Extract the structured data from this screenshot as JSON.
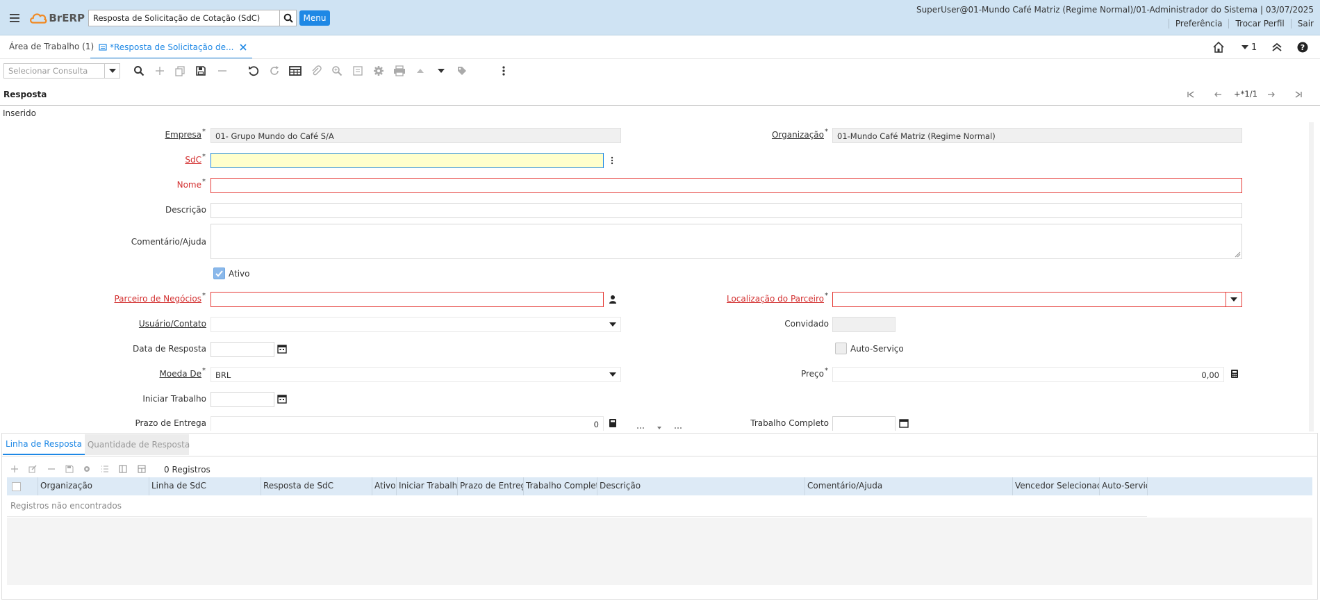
{
  "header": {
    "logo": "BrERP",
    "search_value": "Resposta de Solicitação de Cotação (SdC)",
    "menu_label": "Menu",
    "user_info": "SuperUser@01-Mundo Café Matriz (Regime Normal)/01-Administrador do Sistema | 03/07/2025",
    "links": [
      "Preferência",
      "Trocar Perfil",
      "Sair"
    ]
  },
  "tabs": {
    "workarea": "Área de Trabalho (1)",
    "active": "*Resposta de Solicitação de..."
  },
  "right_nav": {
    "badge": "1"
  },
  "toolbar": {
    "query_placeholder": "Selecionar Consulta"
  },
  "section": {
    "title": "Resposta",
    "record_count": "+*1/1",
    "status": "Inserido"
  },
  "form": {
    "empresa": {
      "label": "Empresa",
      "value": "01- Grupo Mundo do Café S/A"
    },
    "organizacao": {
      "label": "Organização",
      "value": "01-Mundo Café Matriz (Regime Normal)"
    },
    "sdc": {
      "label": "SdC",
      "value": ""
    },
    "nome": {
      "label": "Nome",
      "value": ""
    },
    "descricao": {
      "label": "Descrição",
      "value": ""
    },
    "comentario": {
      "label": "Comentário/Ajuda",
      "value": ""
    },
    "ativo": {
      "label": "Ativo",
      "checked": true
    },
    "parceiro": {
      "label": "Parceiro de Negócios ",
      "value": ""
    },
    "localizacao": {
      "label": "Localização do Parceiro",
      "value": ""
    },
    "usuario": {
      "label": "Usuário/Contato",
      "value": ""
    },
    "convidado": {
      "label": "Convidado",
      "value": ""
    },
    "data_resposta": {
      "label": "Data de Resposta",
      "value": ""
    },
    "auto_servico": {
      "label": "Auto-Serviço",
      "checked": false
    },
    "moeda": {
      "label": "Moeda De",
      "value": "BRL"
    },
    "preco": {
      "label": "Preço",
      "value": "0,00"
    },
    "iniciar_trabalho": {
      "label": "Iniciar Trabalho",
      "value": ""
    },
    "prazo_entrega": {
      "label": "Prazo de Entrega",
      "value": "0"
    },
    "trabalho_completo": {
      "label": "Trabalho Completo",
      "value": ""
    }
  },
  "bottom": {
    "tab_active": "Linha de Resposta",
    "tab_inactive": "Quantidade de Resposta",
    "count": "0 Registros",
    "columns": [
      "Organização",
      "Linha de SdC",
      "Resposta de SdC",
      "Ativo",
      "Iniciar Trabalho",
      "Prazo de Entrega",
      "Trabalho Completo",
      "Descrição",
      "Comentário/Ajuda",
      "Vencedor Selecionado",
      "Auto-Serviço"
    ],
    "empty_message": "Registros não encontrados"
  },
  "colors": {
    "accent": "#1e88e5",
    "header_bg": "#cfe3f3",
    "error": "#e53935",
    "mandatory_field": "#ffffcc"
  }
}
